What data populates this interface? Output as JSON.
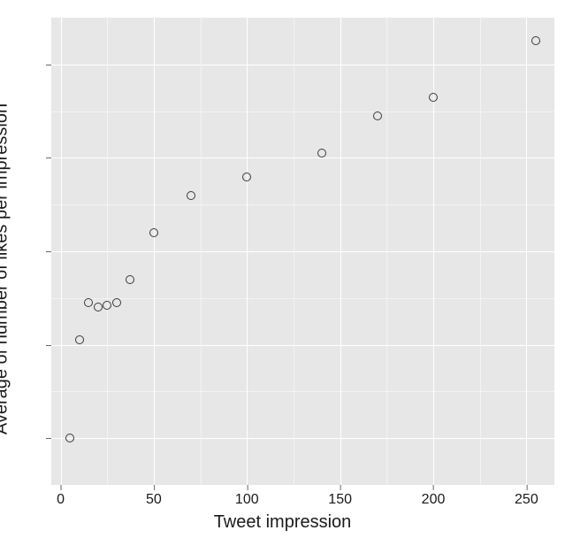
{
  "chart_data": {
    "type": "scatter",
    "title": "",
    "xlabel": "Tweet impression",
    "ylabel": "Average of number of likes per impression",
    "xlim": [
      -5,
      265
    ],
    "ylim": [
      0,
      5
    ],
    "x_ticks": [
      0,
      50,
      100,
      150,
      200,
      250
    ],
    "x_minor_ticks": [
      25,
      75,
      125,
      175,
      225
    ],
    "y_major_count": 5,
    "y_minor_between": true,
    "x": [
      5,
      10,
      15,
      20,
      25,
      30,
      37,
      50,
      70,
      100,
      140,
      170,
      200,
      255
    ],
    "y": [
      0.5,
      1.55,
      1.95,
      1.9,
      1.92,
      1.95,
      2.2,
      2.7,
      3.1,
      3.3,
      3.55,
      3.95,
      4.15,
      4.75
    ],
    "colors": {
      "panel": "#e7e7e7",
      "grid": "#ffffff",
      "point_stroke": "#3a3a3a"
    }
  }
}
